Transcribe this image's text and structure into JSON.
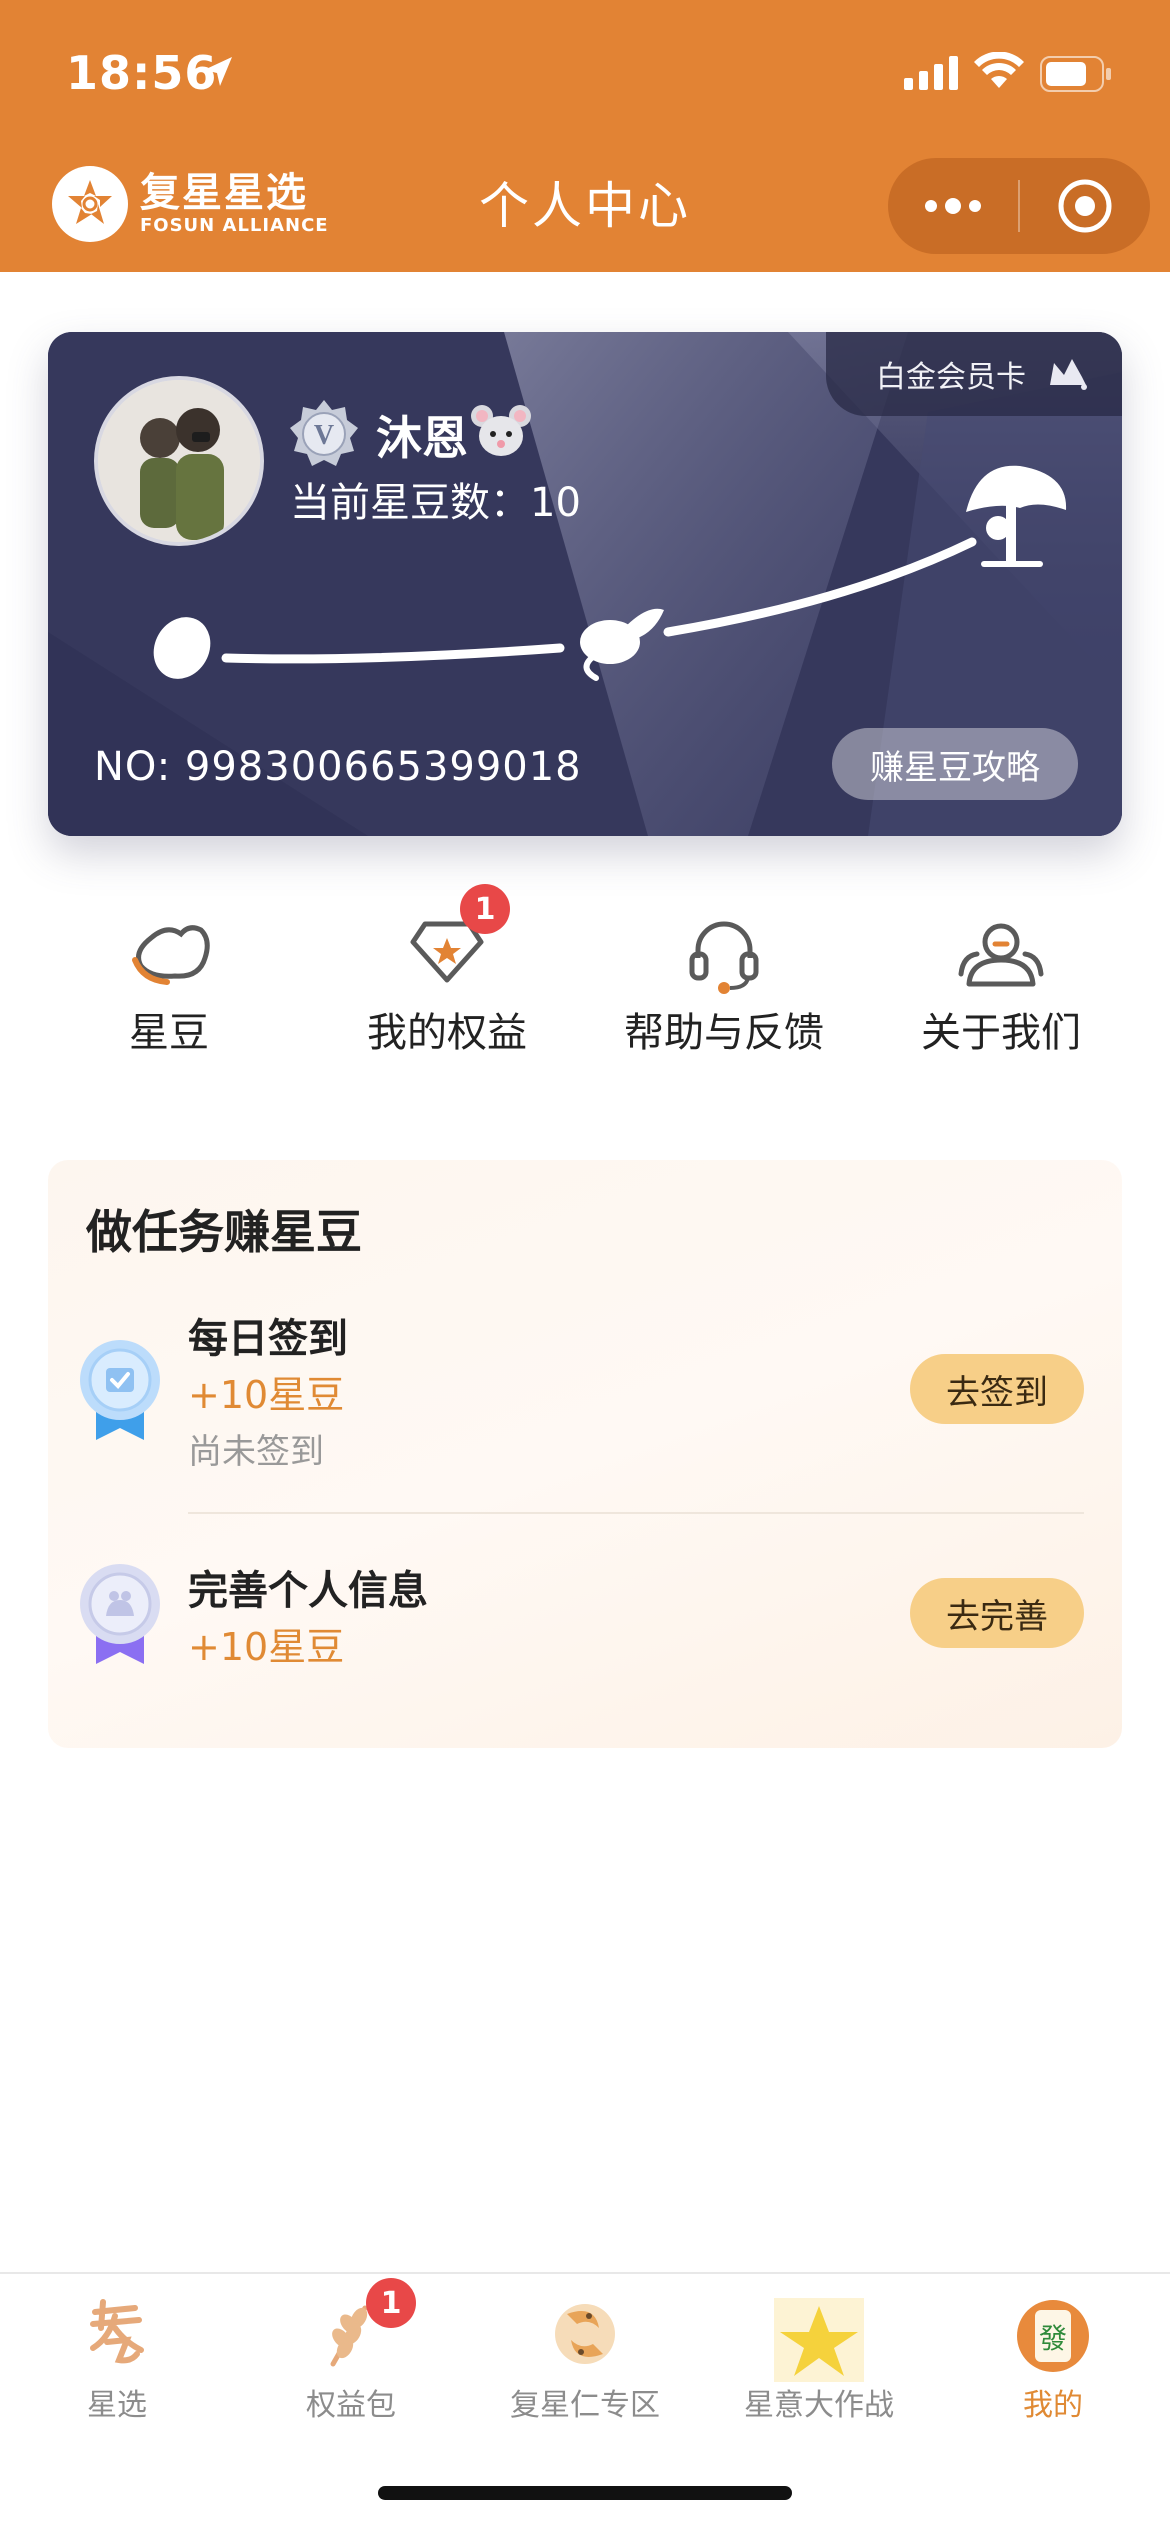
{
  "status_bar": {
    "time": "18:56"
  },
  "header": {
    "brand_cn": "复星星选",
    "brand_en": "FOSUN ALLIANCE",
    "title": "个人中心"
  },
  "card": {
    "tier_label": "白金会员卡",
    "username": "沐恩",
    "bean_label": "当前星豆数：",
    "bean_value": "10",
    "number": "NO: 998300665399018",
    "guide_button": "赚星豆攻略"
  },
  "quick_menu": [
    {
      "label": "星豆",
      "icon": "bean-icon"
    },
    {
      "label": "我的权益",
      "icon": "diamond-icon",
      "badge": "1"
    },
    {
      "label": "帮助与反馈",
      "icon": "headset-icon"
    },
    {
      "label": "关于我们",
      "icon": "team-icon"
    }
  ],
  "tasks": {
    "title": "做任务赚星豆",
    "items": [
      {
        "name": "每日签到",
        "reward": "+10星豆",
        "status": "尚未签到",
        "button": "去签到",
        "icon": "checkin-medal-icon"
      },
      {
        "name": "完善个人信息",
        "reward": "+10星豆",
        "button": "去完善",
        "icon": "profile-medal-icon"
      }
    ]
  },
  "tabbar": {
    "items": [
      {
        "label": "星选",
        "icon": "xingxuan-icon"
      },
      {
        "label": "权益包",
        "icon": "wheat-icon",
        "badge": "1"
      },
      {
        "label": "复星仁专区",
        "icon": "koi-icon"
      },
      {
        "label": "星意大作战",
        "icon": "star-icon"
      },
      {
        "label": "我的",
        "icon": "mahjong-icon",
        "active": true
      }
    ],
    "active_color": "#e08a34"
  },
  "colors": {
    "brand_orange": "#e28334",
    "card_navy": "#3b3d63",
    "badge_red": "#e84848"
  }
}
